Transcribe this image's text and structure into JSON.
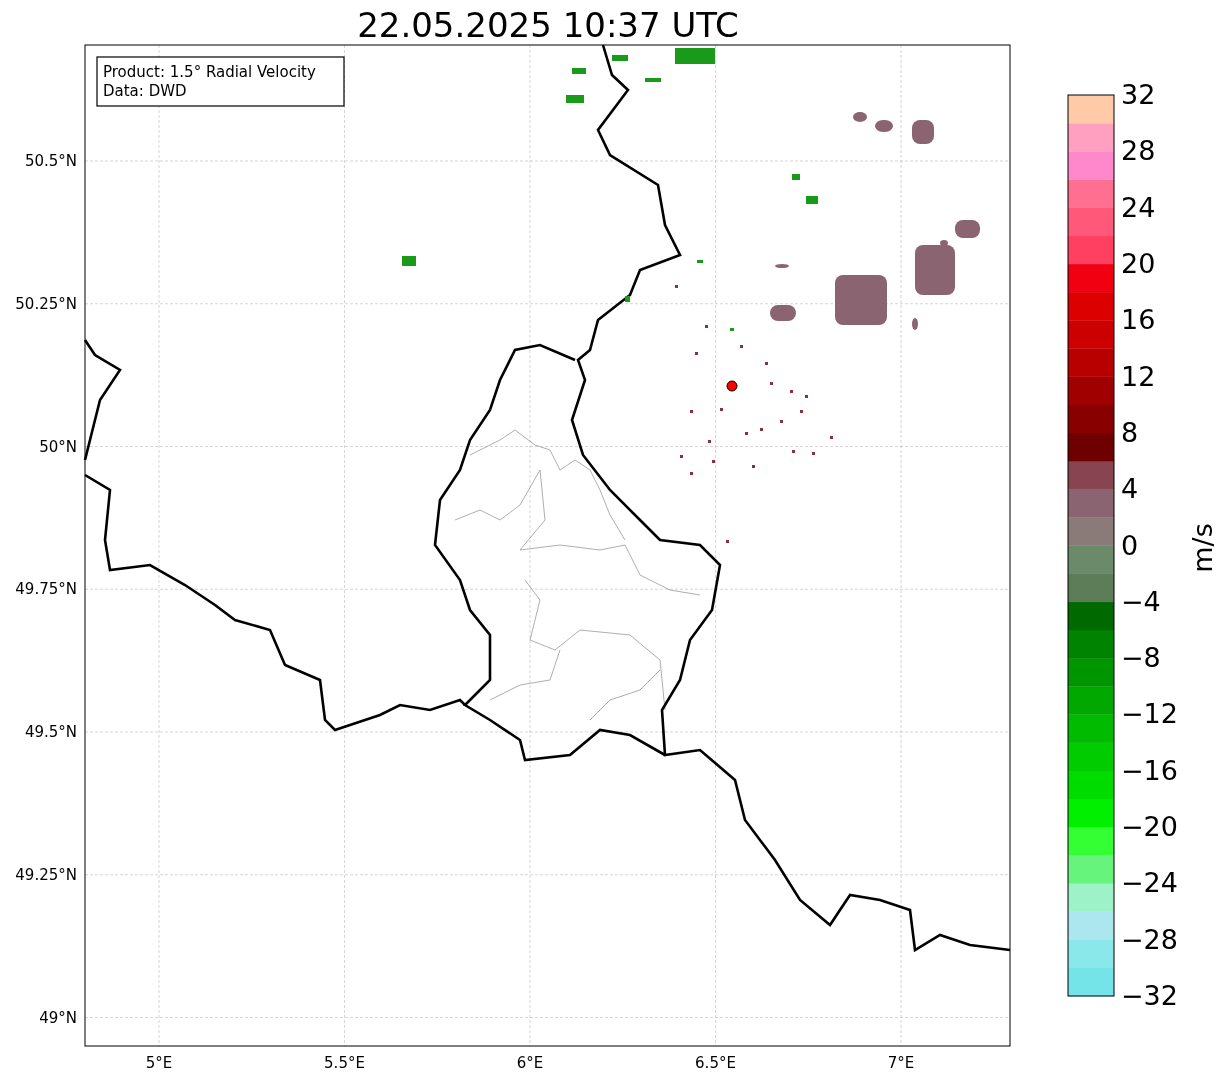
{
  "title": "22.05.2025 10:37 UTC",
  "info_box": {
    "lines": [
      "Product: 1.5° Radial Velocity",
      "Data: DWD"
    ]
  },
  "map": {
    "x_ticks": [
      "5°E",
      "5.5°E",
      "6°E",
      "6.5°E",
      "7°E"
    ],
    "y_ticks": [
      "50.5°N",
      "50.25°N",
      "50°N",
      "49.75°N",
      "49.5°N",
      "49.25°N",
      "49°N"
    ]
  },
  "colorbar": {
    "label": "m/s",
    "ticks": [
      "32",
      "28",
      "24",
      "20",
      "16",
      "12",
      "8",
      "4",
      "0",
      "−4",
      "−8",
      "−12",
      "−16",
      "−20",
      "−24",
      "−28",
      "−32"
    ],
    "bands": [
      {
        "color": "#74e4e8"
      },
      {
        "color": "#8ae8ea"
      },
      {
        "color": "#ace6ee"
      },
      {
        "color": "#9ef2c8"
      },
      {
        "color": "#66f47c"
      },
      {
        "color": "#33ff33"
      },
      {
        "color": "#00f000"
      },
      {
        "color": "#00dc00"
      },
      {
        "color": "#00cc00"
      },
      {
        "color": "#00bb00"
      },
      {
        "color": "#00a800"
      },
      {
        "color": "#009600"
      },
      {
        "color": "#008400"
      },
      {
        "color": "#006a00"
      },
      {
        "color": "#5c7d58"
      },
      {
        "color": "#6b8a6a"
      },
      {
        "color": "#8a7a78"
      },
      {
        "color": "#8a6470"
      },
      {
        "color": "#884450"
      },
      {
        "color": "#6e0000"
      },
      {
        "color": "#880000"
      },
      {
        "color": "#a00000"
      },
      {
        "color": "#b80000"
      },
      {
        "color": "#cc0000"
      },
      {
        "color": "#dc0000"
      },
      {
        "color": "#f00010"
      },
      {
        "color": "#ff4060"
      },
      {
        "color": "#ff5878"
      },
      {
        "color": "#ff7090"
      },
      {
        "color": "#ff88cc"
      },
      {
        "color": "#ffa0c0"
      },
      {
        "color": "#ffcaa8"
      }
    ]
  }
}
